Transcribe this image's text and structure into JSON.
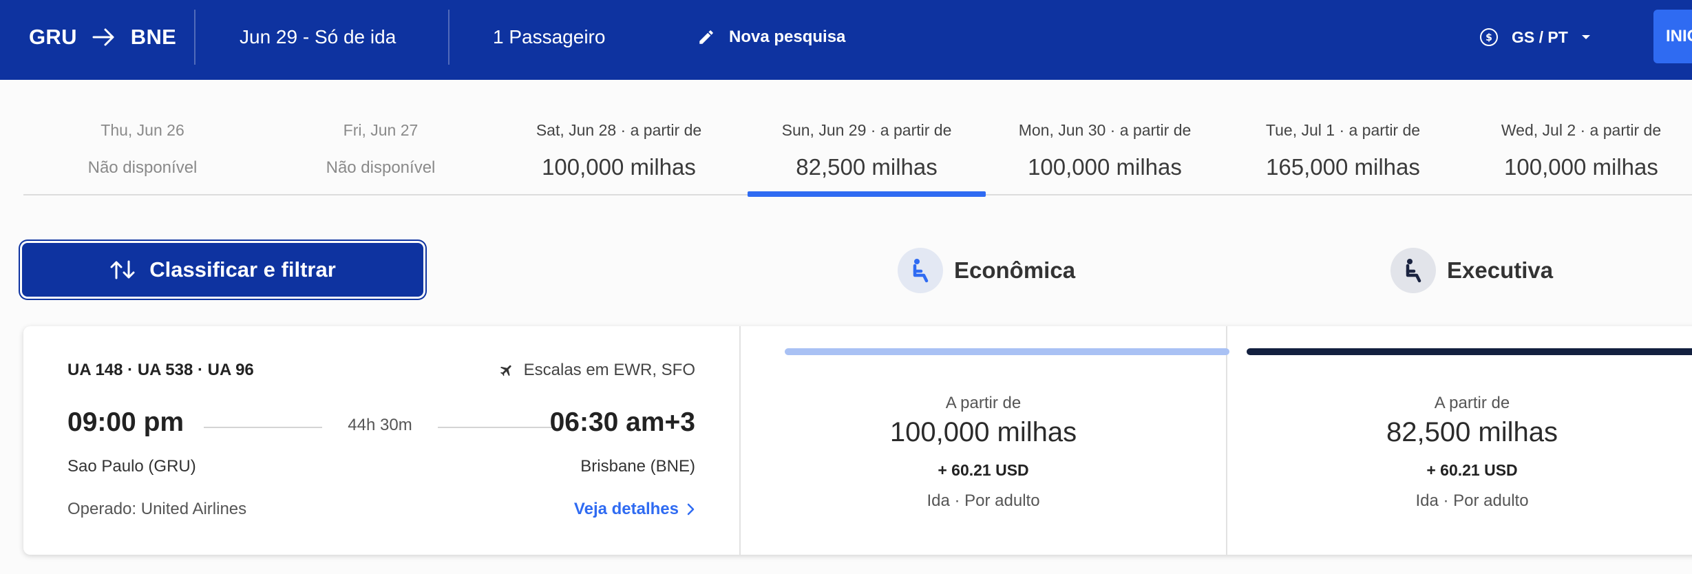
{
  "header": {
    "origin": "GRU",
    "destination": "BNE",
    "date_trip": "Jun 29 - Só de ida",
    "passengers": "1 Passageiro",
    "new_search": "Nova pesquisa",
    "locale": "GS / PT",
    "login": "INIC"
  },
  "dates": [
    {
      "label": "Thu, Jun 26",
      "price": "Não disponível",
      "available": false
    },
    {
      "label": "Fri, Jun 27",
      "price": "Não disponível",
      "available": false
    },
    {
      "label": "Sat, Jun 28 · a partir de",
      "price": "100,000 milhas",
      "available": true
    },
    {
      "label": "Sun, Jun 29 · a partir de",
      "price": "82,500 milhas",
      "available": true,
      "selected": true
    },
    {
      "label": "Mon, Jun 30 · a partir de",
      "price": "100,000 milhas",
      "available": true
    },
    {
      "label": "Tue, Jul 1 · a partir de",
      "price": "165,000 milhas",
      "available": true
    },
    {
      "label": "Wed, Jul 2 · a partir de",
      "price": "100,000 milhas",
      "available": true
    }
  ],
  "sort_filter_label": "Classificar e filtrar",
  "cabins": {
    "economy": {
      "label": "Econômica",
      "icon": "seat-icon",
      "color": "#2f6bf2"
    },
    "business": {
      "label": "Executiva",
      "icon": "seat-icon",
      "color": "#1b2440"
    }
  },
  "flight": {
    "numbers": "UA 148 · UA 538 · UA 96",
    "stops": "Escalas em EWR, SFO",
    "departure_time": "09:00 pm",
    "arrival_time": "06:30 am+3",
    "duration": "44h 30m",
    "departure_city": "Sao Paulo (GRU)",
    "arrival_city": "Brisbane (BNE)",
    "operator": "Operado: United Airlines",
    "details_link": "Veja detalhes",
    "fares": {
      "economy": {
        "from": "A partir de",
        "miles": "100,000 milhas",
        "tax": "+ 60.21 USD",
        "note": "Ida · Por adulto",
        "bar_color": "#a9c1f4"
      },
      "business": {
        "from": "A partir de",
        "miles": "82,500 milhas",
        "tax": "+ 60.21 USD",
        "note": "Ida · Por adulto",
        "bar_color": "#13203f"
      }
    }
  },
  "colors": {
    "header_bg": "#0e33a0",
    "accent": "#2f6bf2"
  }
}
